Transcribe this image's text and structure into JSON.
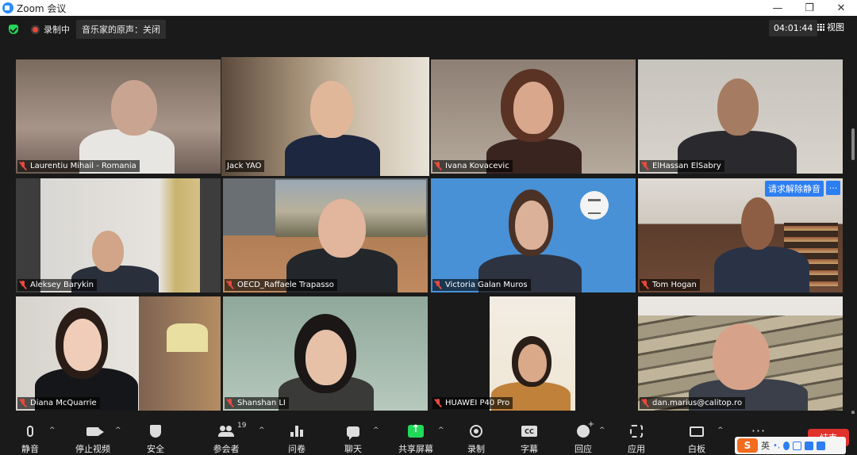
{
  "window": {
    "title": "Zoom 会议",
    "controls": [
      "—",
      "❐",
      "✕"
    ]
  },
  "topbar": {
    "recording": "录制中",
    "original_sound": "音乐家的原声：关闭",
    "timer": "04:01:44",
    "view": "视图"
  },
  "participants": [
    {
      "name": "Laurentiu Mihail - Romania",
      "muted": true
    },
    {
      "name": "Jack YAO",
      "muted": false,
      "active_speaker": true
    },
    {
      "name": "Ivana Kovacevic",
      "muted": true
    },
    {
      "name": "ElHassan ElSabry",
      "muted": true
    },
    {
      "name": "Aleksey Barykin",
      "muted": true
    },
    {
      "name": "OECD_Raffaele Trapasso",
      "muted": true
    },
    {
      "name": "Victoria Galan Muros",
      "muted": true
    },
    {
      "name": "Tom Hogan",
      "muted": true,
      "request_unmute": "请求解除静音",
      "more": "···"
    },
    {
      "name": "Diana McQuarrie",
      "muted": true
    },
    {
      "name": "Shanshan LI",
      "muted": true
    },
    {
      "name": "HUAWEI P40 Pro",
      "muted": true
    },
    {
      "name": "dan.marius@calitop.ro",
      "muted": true
    }
  ],
  "toolbar": {
    "mute": "静音",
    "stop_video": "停止视频",
    "security": "安全",
    "participants": "参会者",
    "participant_count": "19",
    "polls": "问卷",
    "chat": "聊天",
    "share_screen": "共享屏幕",
    "record": "录制",
    "captions": "字幕",
    "reactions": "回应",
    "apps": "应用",
    "whiteboard": "白板",
    "more": "···",
    "end": "结束"
  },
  "ime": {
    "logo": "S",
    "lang": "英"
  },
  "colors": {
    "accent": "#2d7ef2",
    "share": "#23d959",
    "end": "#e0322c",
    "active_border": "#e7f05a",
    "muted": "#e84a3c"
  }
}
